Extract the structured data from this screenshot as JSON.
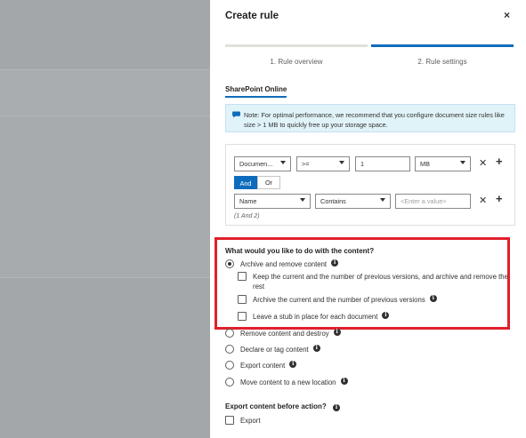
{
  "dialog": {
    "title": "Create rule",
    "close_glyph": "×"
  },
  "steps": [
    {
      "label": "1. Rule overview",
      "state": "completed"
    },
    {
      "label": "2. Rule settings",
      "state": "active"
    }
  ],
  "source_tab": "SharePoint Online",
  "note": {
    "icon": "chat-bubble-icon",
    "text": "Note: For optimal performance, we recommend that you configure document size rules like size > 1 MB to quickly free up your storage space."
  },
  "filters": {
    "row1": {
      "field": "Documen...",
      "operator": ">=",
      "value": "1",
      "unit": "MB"
    },
    "logic": {
      "and_label": "And",
      "or_label": "Or",
      "selected": "And"
    },
    "row2": {
      "field": "Name",
      "operator": "Contains",
      "value_placeholder": "<Enter a value>"
    },
    "expression": "(1 And 2)",
    "remove_glyph": "✕",
    "add_glyph": "+"
  },
  "action": {
    "question": "What would you like to do with the content?",
    "options": [
      {
        "label": "Archive and remove content",
        "selected": true
      },
      {
        "label": "Remove content and destroy",
        "selected": false
      },
      {
        "label": "Declare or tag content",
        "selected": false
      },
      {
        "label": "Export content",
        "selected": false
      },
      {
        "label": "Move content to a new location",
        "selected": false
      }
    ],
    "sub_options": [
      {
        "label": "Keep the current and the number of previous versions, and archive and remove the rest",
        "checked": false
      },
      {
        "label": "Archive the current and the number of previous versions",
        "checked": false
      },
      {
        "label": "Leave a stub in place for each document",
        "checked": false
      }
    ]
  },
  "export_before": {
    "question": "Export content before action?",
    "checkbox_label": "Export",
    "checked": false
  },
  "info_glyph": "i",
  "colors": {
    "accent": "#0f6cbd",
    "highlight": "#e0202a",
    "note_bg": "#e0f3f8"
  }
}
